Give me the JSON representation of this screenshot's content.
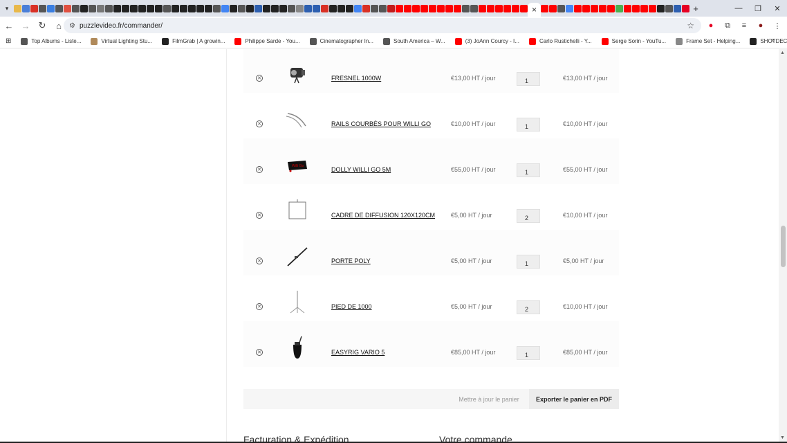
{
  "browser": {
    "active_tab_close": "×",
    "new_tab": "+",
    "url": "puzzlevideo.fr/commander/",
    "tab_favicon_colors": [
      "#e8b84a",
      "#4a7fd8",
      "#d93025",
      "#555",
      "#3a7ee0",
      "#555",
      "#e05040",
      "#555",
      "#222",
      "#555",
      "#777",
      "#555",
      "#222",
      "#222",
      "#222",
      "#222",
      "#222",
      "#222",
      "#555",
      "#222",
      "#222",
      "#222",
      "#222",
      "#222",
      "#555",
      "#4285f4",
      "#222",
      "#555",
      "#222",
      "#2d5fb0",
      "#222",
      "#222",
      "#222",
      "#555",
      "#888",
      "#2d5fb0",
      "#2d5fb0",
      "#d93025",
      "#222",
      "#222",
      "#222",
      "#4285f4",
      "#d93025",
      "#555",
      "#555",
      "#c21a1a",
      "#ff0000",
      "#ff0000",
      "#ff0000",
      "#ff0000",
      "#ff0000",
      "#ff0000",
      "#ff0000",
      "#ff0000",
      "#555",
      "#555",
      "#ff0000",
      "#ff0000",
      "#ff0000",
      "#ff0000",
      "#ff0000",
      "#ff0000"
    ],
    "right_favicon_colors": [
      "#ff0000",
      "#ff0000",
      "#555",
      "#4285f4",
      "#ff0000",
      "#ff0000",
      "#ff0000",
      "#ff0000",
      "#ff0000",
      "#4caf50",
      "#ff0000",
      "#ff0000",
      "#ff0000",
      "#ff0000",
      "#222",
      "#555",
      "#2d5fb0",
      "#e60023"
    ],
    "bookmarks": [
      {
        "label": "Top Albums - Liste...",
        "color": "#555"
      },
      {
        "label": "Virtual Lighting Stu...",
        "color": "#b08a5a"
      },
      {
        "label": "FilmGrab | A growin...",
        "color": "#222"
      },
      {
        "label": "Philippe Sarde - You...",
        "color": "#ff0000"
      },
      {
        "label": "Cinematographer In...",
        "color": "#555"
      },
      {
        "label": "South America – W...",
        "color": "#555"
      },
      {
        "label": "(3) JoAnn Courcy - I...",
        "color": "#ff0000"
      },
      {
        "label": "Carlo Rustichelli - Y...",
        "color": "#ff0000"
      },
      {
        "label": "Serge Sorin - YouTu...",
        "color": "#ff0000"
      },
      {
        "label": "Frame Set - Helping...",
        "color": "#888"
      },
      {
        "label": "SHOTDECK :: Fully S...",
        "color": "#222"
      }
    ]
  },
  "cart": {
    "items": [
      {
        "name": "FRESNEL 1000W",
        "price": "€13,00 HT / jour",
        "qty": "1",
        "subtotal": "€13,00 HT / jour",
        "image": "fresnel-light"
      },
      {
        "name": "RAILS COURBÉS POUR WILLI GO",
        "price": "€10,00 HT / jour",
        "qty": "1",
        "subtotal": "€10,00 HT / jour",
        "image": "curved-rails"
      },
      {
        "name": "DOLLY WILLI GO 5M",
        "price": "€55,00 HT / jour",
        "qty": "1",
        "subtotal": "€55,00 HT / jour",
        "image": "dolly"
      },
      {
        "name": "CADRE DE DIFFUSION 120x120CM",
        "price": "€5,00 HT / jour",
        "qty": "2",
        "subtotal": "€10,00 HT / jour",
        "image": "diffusion-frame"
      },
      {
        "name": "PORTE POLY",
        "price": "€5,00 HT / jour",
        "qty": "1",
        "subtotal": "€5,00 HT / jour",
        "image": "poly-holder"
      },
      {
        "name": "PIED DE 1000",
        "price": "€5,00 HT / jour",
        "qty": "2",
        "subtotal": "€10,00 HT / jour",
        "image": "light-stand"
      },
      {
        "name": "EASYRIG VARIO 5",
        "price": "€85,00 HT / jour",
        "qty": "1",
        "subtotal": "€85,00 HT / jour",
        "image": "easyrig"
      }
    ],
    "update_button": "Mettre à jour le panier",
    "export_button": "Exporter le panier en PDF"
  },
  "sections": {
    "billing": "Facturation & Expédition",
    "order": "Votre commande"
  }
}
